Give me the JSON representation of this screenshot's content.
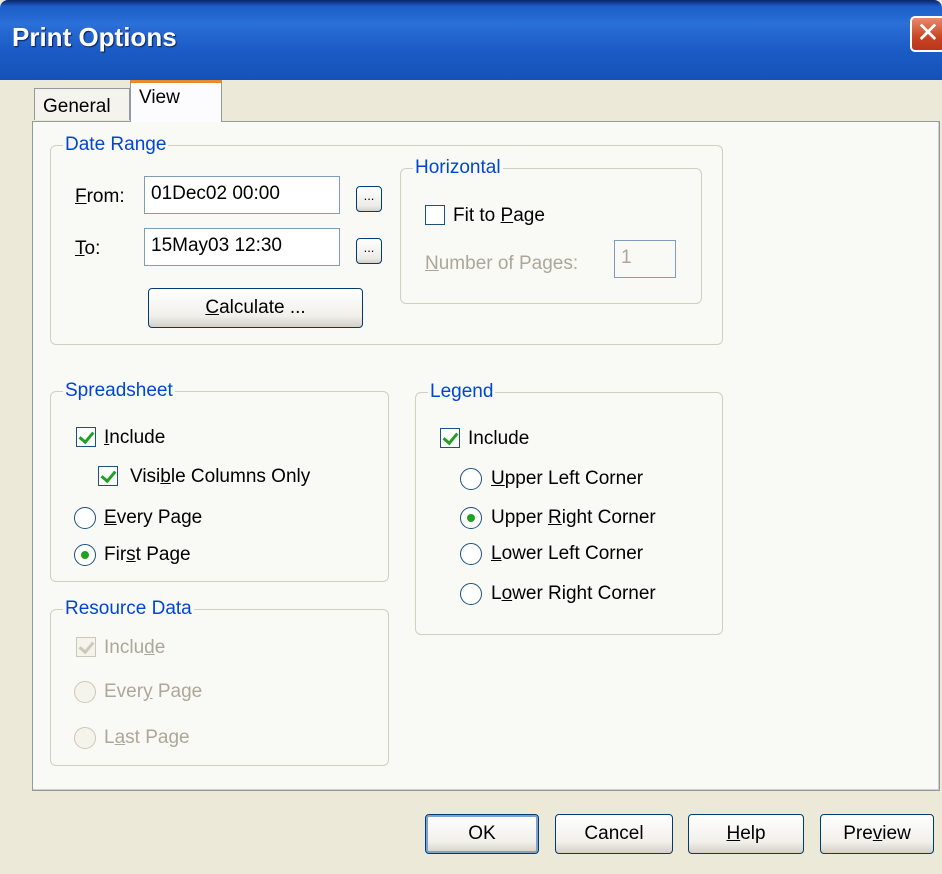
{
  "window": {
    "title": "Print Options",
    "close_glyph": "✕"
  },
  "tabs": {
    "general": "General",
    "view": "View"
  },
  "date_range": {
    "legend": "Date Range",
    "from_label_u": "F",
    "from_label_rest": "rom:",
    "from_value": "01Dec02 00:00",
    "to_label_u": "T",
    "to_label_rest": "o:",
    "to_value": "15May03 12:30",
    "browse_label": "...",
    "calculate_u": "C",
    "calculate_rest": "alculate ..."
  },
  "horizontal": {
    "legend": "Horizontal",
    "fit_pre": "Fit to ",
    "fit_u": "P",
    "fit_post": "age",
    "fit_checked": false,
    "pages_u": "N",
    "pages_rest": "umber of Pages:",
    "pages_value": "1"
  },
  "spreadsheet": {
    "legend": "Spreadsheet",
    "include_u": "I",
    "include_rest": "nclude",
    "include_checked": true,
    "visible_pre": "Visi",
    "visible_u": "b",
    "visible_post": "le Columns Only",
    "visible_checked": true,
    "every_u": "E",
    "every_rest": "very Page",
    "first_pre": "Fir",
    "first_u": "s",
    "first_post": "t Page",
    "selected": "First Page"
  },
  "resource_data": {
    "legend": "Resource Data",
    "include_pre": "Inclu",
    "include_u": "d",
    "include_post": "e",
    "include_checked": true,
    "every_pre": "Ever",
    "every_u": "y",
    "every_post": " Page",
    "last_pre": "L",
    "last_u": "a",
    "last_post": "st Page"
  },
  "legend_box": {
    "legend": "Legend",
    "include": "Include",
    "include_checked": true,
    "upper_left_u": "U",
    "upper_left_rest": "pper Left Corner",
    "upper_right_pre": "Upper ",
    "upper_right_u": "R",
    "upper_right_post": "ight Corner",
    "lower_left_u": "L",
    "lower_left_rest": "ower Left Corner",
    "lower_right_pre": "L",
    "lower_right_u": "o",
    "lower_right_post": "wer Right Corner",
    "selected": "Upper Right Corner"
  },
  "buttons": {
    "ok": "OK",
    "cancel": "Cancel",
    "help_u": "H",
    "help_rest": "elp",
    "preview_pre": "Pre",
    "preview_u": "v",
    "preview_post": "iew"
  },
  "colors": {
    "title_bar": "#2b6fd8",
    "group_legend": "#0046d5",
    "check_mark": "#21a121",
    "dialog_bg": "#ece9d8"
  }
}
